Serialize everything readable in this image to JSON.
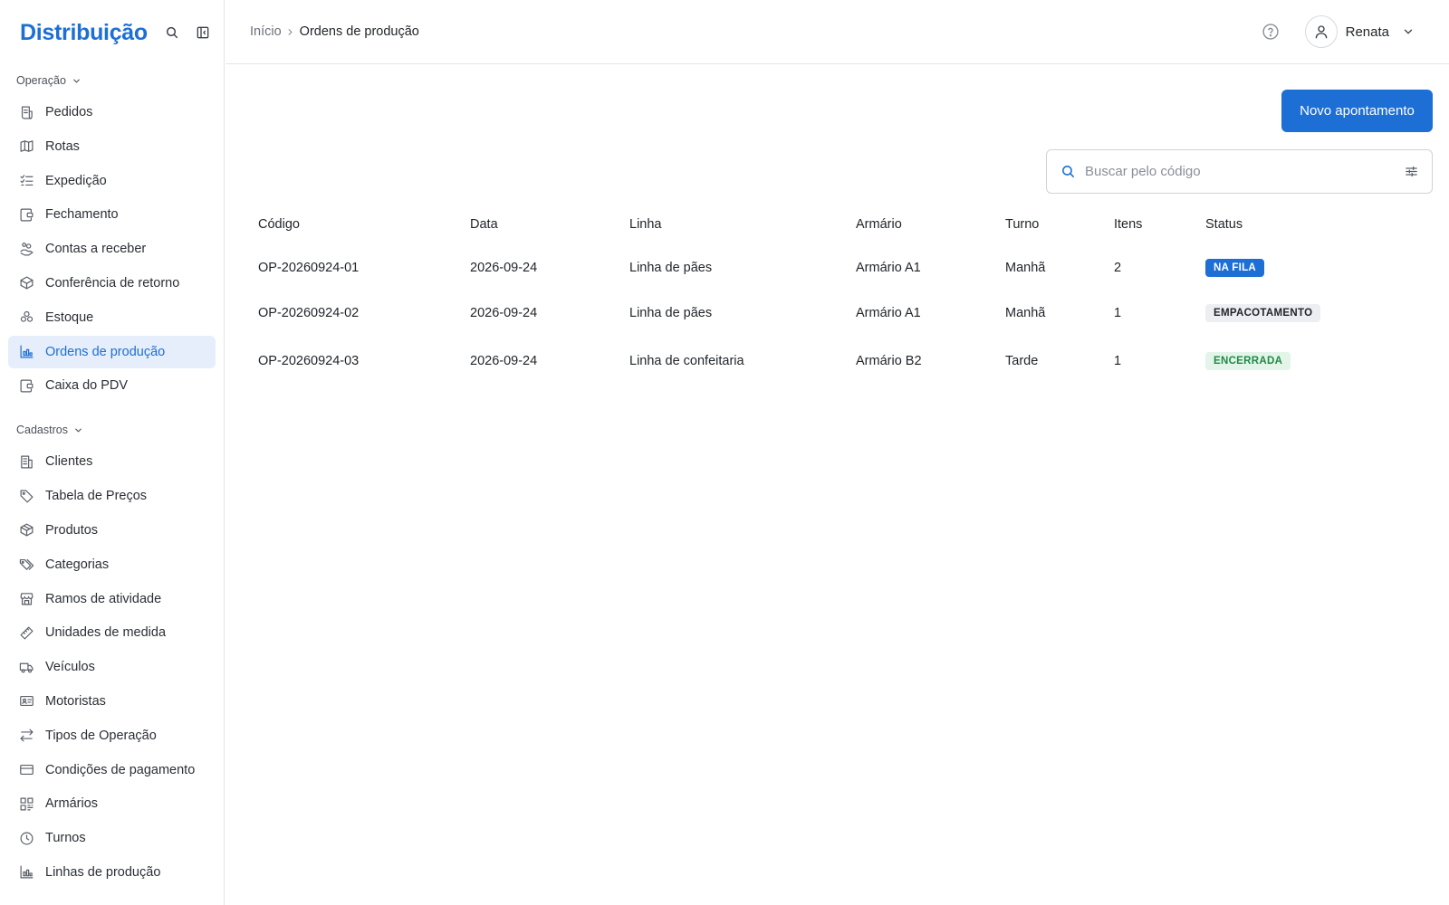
{
  "app": {
    "title": "Distribuição"
  },
  "sidebar": {
    "sections": [
      {
        "label": "Operação",
        "items": [
          {
            "label": "Pedidos",
            "icon": "receipt-icon"
          },
          {
            "label": "Rotas",
            "icon": "map-icon"
          },
          {
            "label": "Expedição",
            "icon": "checklist-icon"
          },
          {
            "label": "Fechamento",
            "icon": "wallet-icon"
          },
          {
            "label": "Contas a receber",
            "icon": "hand-coins-icon"
          },
          {
            "label": "Conferência de retorno",
            "icon": "package-check-icon"
          },
          {
            "label": "Estoque",
            "icon": "boxes-icon"
          },
          {
            "label": "Ordens de produção",
            "icon": "factory-chart-icon",
            "active": true
          },
          {
            "label": "Caixa do PDV",
            "icon": "wallet-icon"
          }
        ]
      },
      {
        "label": "Cadastros",
        "items": [
          {
            "label": "Clientes",
            "icon": "building-icon"
          },
          {
            "label": "Tabela de Preços",
            "icon": "tag-icon"
          },
          {
            "label": "Produtos",
            "icon": "package-icon"
          },
          {
            "label": "Categorias",
            "icon": "tags-icon"
          },
          {
            "label": "Ramos de atividade",
            "icon": "store-icon"
          },
          {
            "label": "Unidades de medida",
            "icon": "ruler-icon"
          },
          {
            "label": "Veículos",
            "icon": "truck-icon"
          },
          {
            "label": "Motoristas",
            "icon": "id-card-icon"
          },
          {
            "label": "Tipos de Operação",
            "icon": "arrows-swap-icon"
          },
          {
            "label": "Condições de pagamento",
            "icon": "credit-card-icon"
          },
          {
            "label": "Armários",
            "icon": "qr-grid-icon"
          },
          {
            "label": "Turnos",
            "icon": "clock-icon"
          },
          {
            "label": "Linhas de produção",
            "icon": "factory-chart-icon"
          }
        ]
      }
    ]
  },
  "header": {
    "breadcrumb": {
      "home": "Início",
      "current": "Ordens de produção"
    },
    "user": {
      "name": "Renata"
    }
  },
  "main": {
    "new_button": "Novo apontamento",
    "search": {
      "placeholder": "Buscar pelo código",
      "value": ""
    },
    "table": {
      "columns": [
        "Código",
        "Data",
        "Linha",
        "Armário",
        "Turno",
        "Itens",
        "Status"
      ],
      "rows": [
        {
          "code": "OP-20260924-01",
          "date": "2026-09-24",
          "line": "Linha de pães",
          "cabinet": "Armário A1",
          "shift": "Manhã",
          "items": "2",
          "status": "NA FILA",
          "status_kind": "queued"
        },
        {
          "code": "OP-20260924-02",
          "date": "2026-09-24",
          "line": "Linha de pães",
          "cabinet": "Armário A1",
          "shift": "Manhã",
          "items": "1",
          "status": "EMPACOTAMENTO",
          "status_kind": "packing"
        },
        {
          "code": "OP-20260924-03",
          "date": "2026-09-24",
          "line": "Linha de confeitaria",
          "cabinet": "Armário B2",
          "shift": "Tarde",
          "items": "1",
          "status": "ENCERRADA",
          "status_kind": "closed"
        }
      ]
    }
  },
  "colors": {
    "accent": "#1d6fd6",
    "active_bg": "#e6eefb",
    "closed_bg": "#e2f5e8",
    "closed_text": "#1f8a45",
    "packing_bg": "#eceef1"
  }
}
